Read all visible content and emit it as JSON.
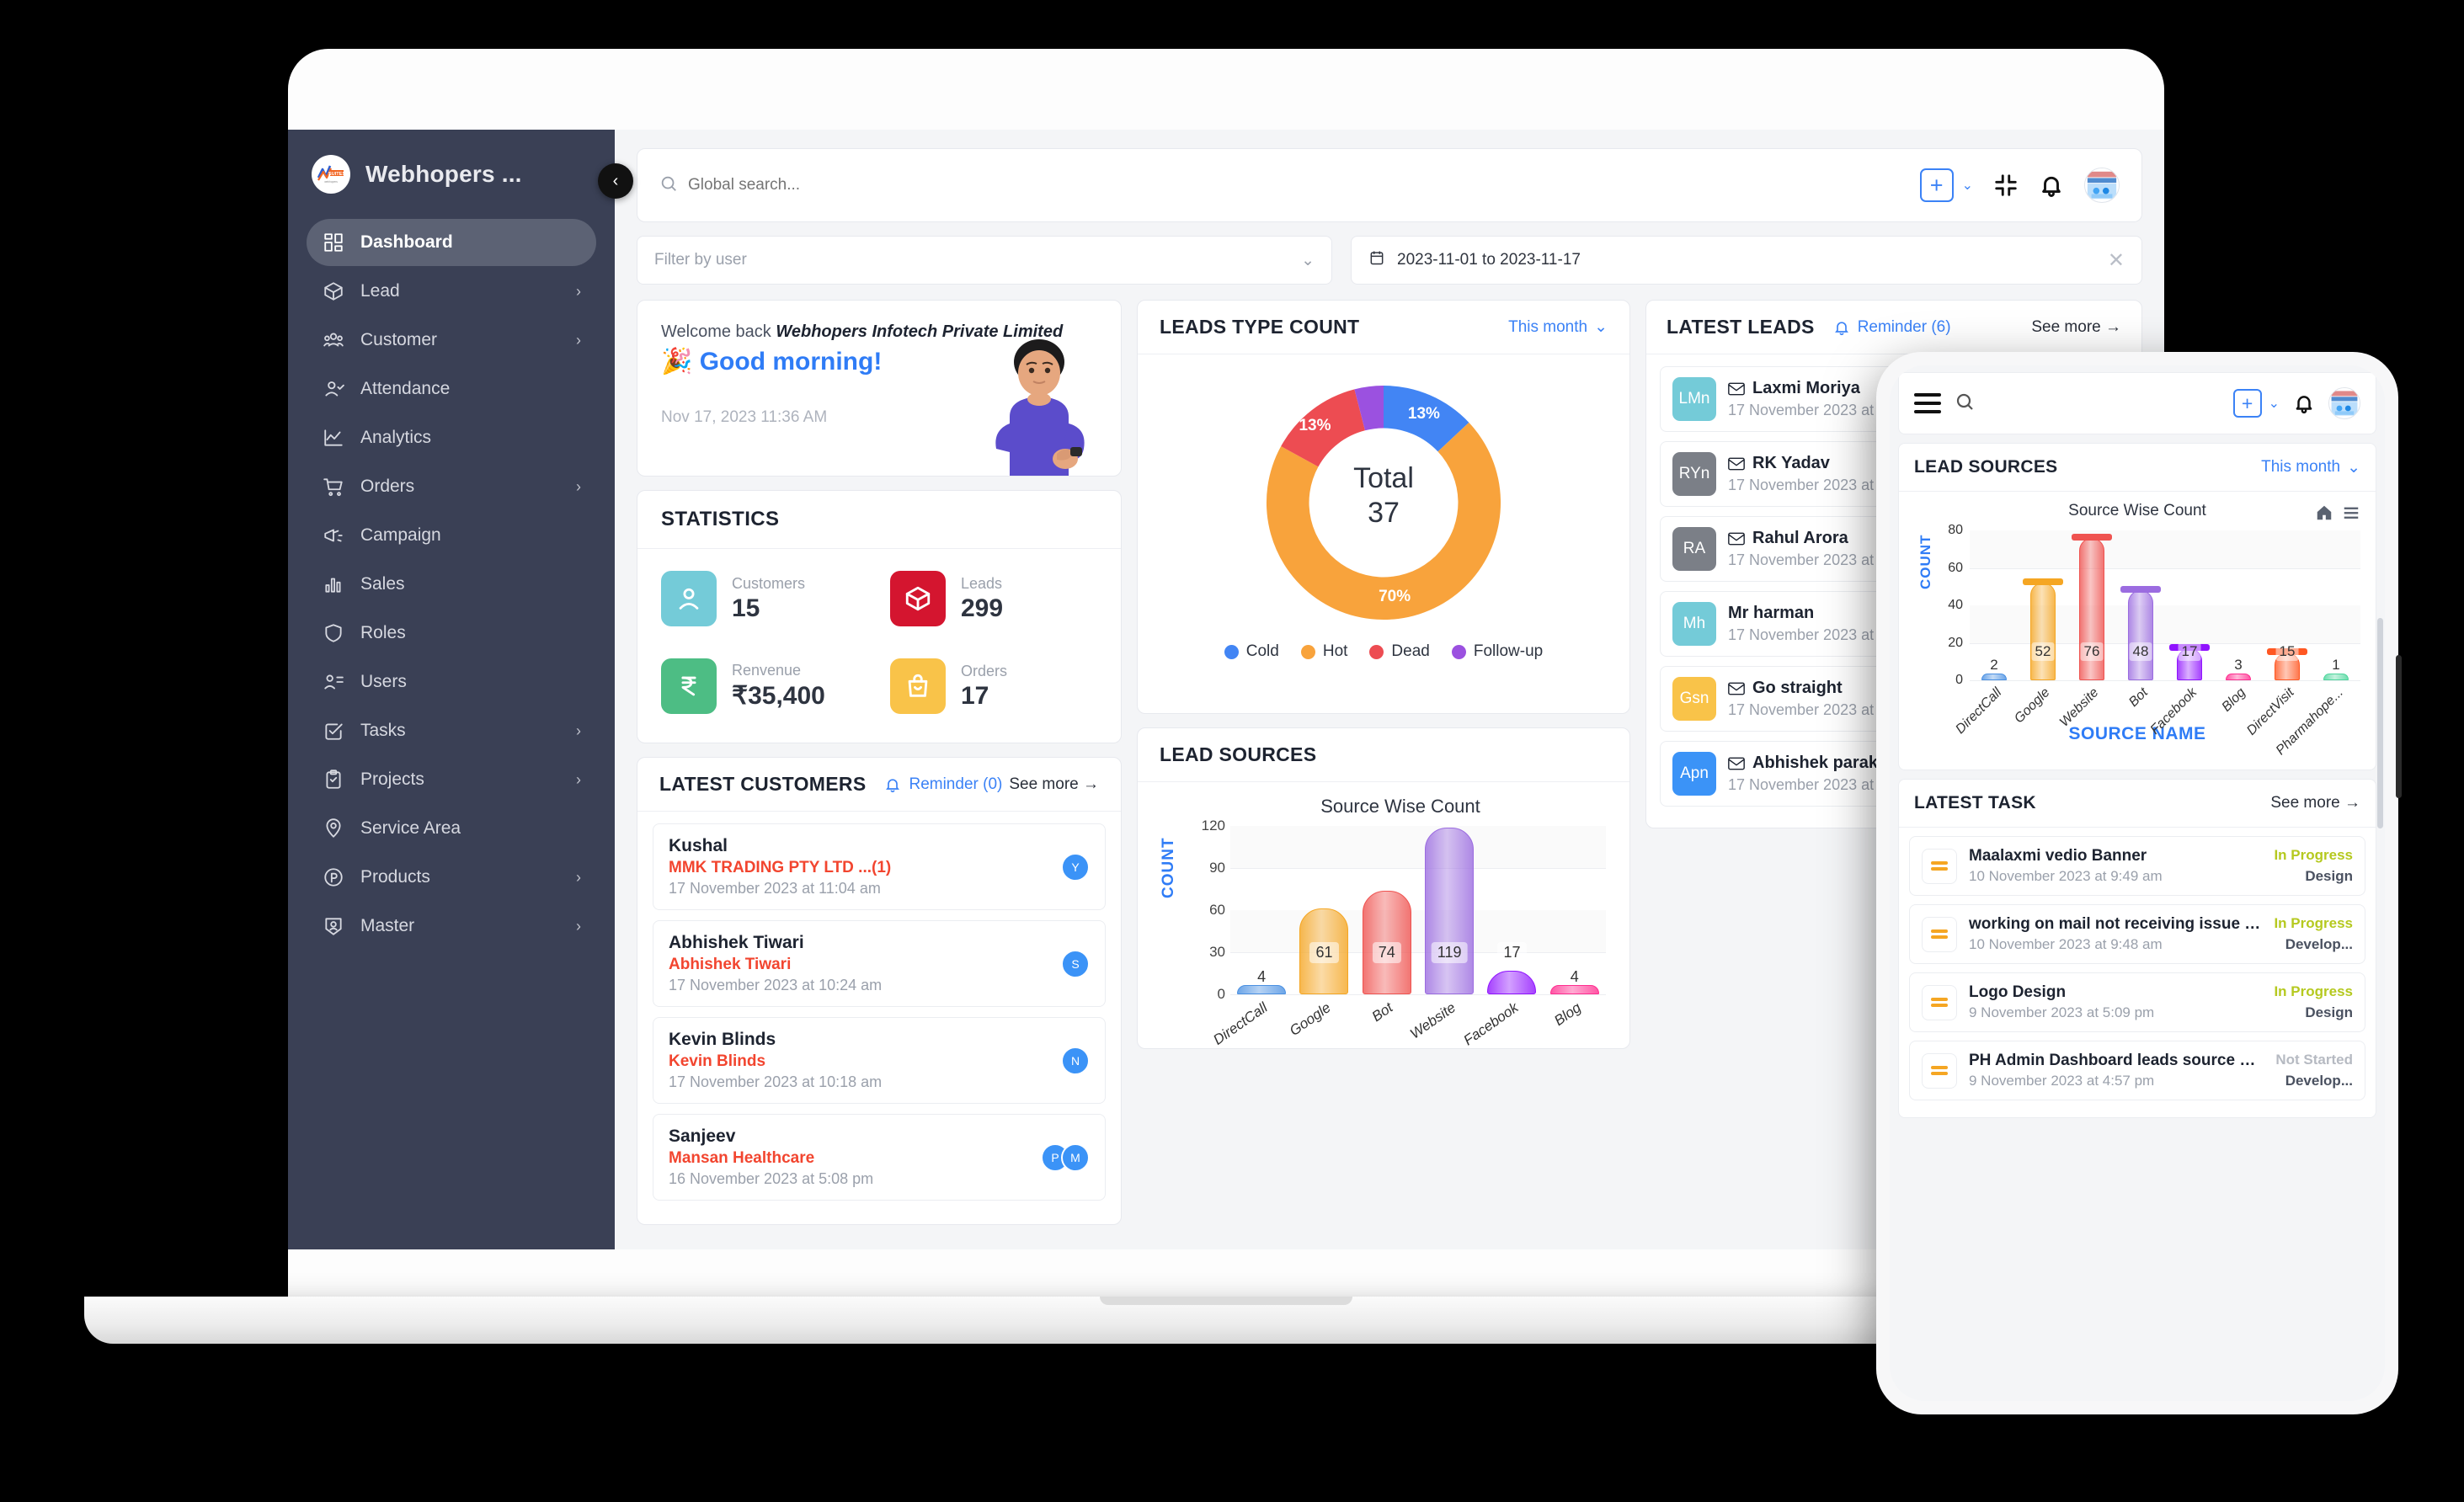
{
  "sidebar": {
    "brand": "Webhopers ...",
    "logo_text": "WHSUITES",
    "collapse": "‹",
    "items": [
      {
        "label": "Dashboard",
        "icon": "grid-icon",
        "arrow": "",
        "active": true
      },
      {
        "label": "Lead",
        "icon": "box-icon",
        "arrow": "›",
        "active": false
      },
      {
        "label": "Customer",
        "icon": "people-icon",
        "arrow": "›",
        "active": false
      },
      {
        "label": "Attendance",
        "icon": "user-check-icon",
        "arrow": "",
        "active": false
      },
      {
        "label": "Analytics",
        "icon": "line-chart-icon",
        "arrow": "",
        "active": false
      },
      {
        "label": "Orders",
        "icon": "cart-icon",
        "arrow": "›",
        "active": false
      },
      {
        "label": "Campaign",
        "icon": "megaphone-icon",
        "arrow": "",
        "active": false
      },
      {
        "label": "Sales",
        "icon": "bar-chart-icon",
        "arrow": "",
        "active": false
      },
      {
        "label": "Roles",
        "icon": "shield-icon",
        "arrow": "",
        "active": false
      },
      {
        "label": "Users",
        "icon": "users-list-icon",
        "arrow": "",
        "active": false
      },
      {
        "label": "Tasks",
        "icon": "check-square-icon",
        "arrow": "›",
        "active": false
      },
      {
        "label": "Projects",
        "icon": "clipboard-icon",
        "arrow": "›",
        "active": false
      },
      {
        "label": "Service Area",
        "icon": "map-pin-icon",
        "arrow": "",
        "active": false
      },
      {
        "label": "Products",
        "icon": "p-circle-icon",
        "arrow": "›",
        "active": false
      },
      {
        "label": "Master",
        "icon": "badge-user-icon",
        "arrow": "›",
        "active": false
      }
    ]
  },
  "topbar": {
    "search_placeholder": "Global search...",
    "search_value": "",
    "plus_label": "+",
    "chevron": "⌄"
  },
  "filters": {
    "user_placeholder": "Filter by user",
    "user_chevron": "⌄",
    "date_value": "2023-11-01 to 2023-11-17",
    "clear": "✕"
  },
  "welcome": {
    "greeting_prefix": "Welcome back ",
    "company": "Webhopers Infotech Private Limited",
    "emoji": "🎉",
    "greeting": "Good morning!",
    "timestamp": "Nov 17, 2023 11:36 AM"
  },
  "statistics": {
    "title": "STATISTICS",
    "items": [
      {
        "label": "Customers",
        "value": "15",
        "color": "#74cbd8",
        "icon": "user-icon"
      },
      {
        "label": "Leads",
        "value": "299",
        "color": "#d4152f",
        "icon": "box-icon"
      },
      {
        "label": "Renvenue",
        "value": "₹35,400",
        "color": "#4dbd84",
        "icon": "rupee-icon"
      },
      {
        "label": "Orders",
        "value": "17",
        "color": "#f9c349",
        "icon": "bag-icon"
      }
    ]
  },
  "latest_customers": {
    "title": "LATEST CUSTOMERS",
    "reminder": "Reminder (0)",
    "see_more": "See more →",
    "rows": [
      {
        "name": "Kushal",
        "org": "MMK TRADING PTY LTD  ...(1)",
        "date": "17 November 2023 at 11:04 am",
        "avatars": [
          "Y"
        ]
      },
      {
        "name": "Abhishek Tiwari",
        "org": "Abhishek Tiwari",
        "date": "17 November 2023 at 10:24 am",
        "avatars": [
          "S"
        ]
      },
      {
        "name": "Kevin Blinds",
        "org": "Kevin Blinds",
        "date": "17 November 2023 at 10:18 am",
        "avatars": [
          "N"
        ]
      },
      {
        "name": "Sanjeev",
        "org": "Mansan Healthcare",
        "date": "16 November 2023 at 5:08 pm",
        "avatars": [
          "P",
          "M"
        ]
      }
    ]
  },
  "leads_type_count": {
    "title": "LEADS TYPE COUNT",
    "period": "This month",
    "chevron": "⌄",
    "center_label": "Total",
    "center_value": "37"
  },
  "lead_sources_desktop": {
    "title": "LEAD SOURCES"
  },
  "latest_leads": {
    "title": "LATEST LEADS",
    "reminder": "Reminder (6)",
    "see_more": "See more →",
    "rows": [
      {
        "initials": "LMn",
        "color": "#74cbd8",
        "name": "Laxmi Moriya",
        "date": "17 November 2023 at 11:",
        "mail": true
      },
      {
        "initials": "RYn",
        "color": "#7b7f87",
        "name": "RK Yadav",
        "date": "17 November 2023 at 10:",
        "mail": true
      },
      {
        "initials": "RA",
        "color": "#7b7f87",
        "name": "Rahul Arora",
        "date": "17 November 2023 at 9:3",
        "mail": true
      },
      {
        "initials": "Mh",
        "color": "#74cbd8",
        "name": "Mr harman",
        "date": "17 November 2023 at 9:0",
        "mail": false
      },
      {
        "initials": "Gsn",
        "color": "#f9c349",
        "name": "Go straight",
        "date": "17 November 2023 at 5:3",
        "mail": true
      },
      {
        "initials": "Apn",
        "color": "#3b93f7",
        "name": "Abhishek parakkat",
        "date": "17 November 2023 at 1:4",
        "mail": true
      }
    ]
  },
  "phone": {
    "lead_sources": {
      "title": "LEAD SOURCES",
      "period": "This month",
      "chevron": "⌄",
      "source_name": "SOURCE NAME"
    },
    "latest_task": {
      "title": "LATEST TASK",
      "see_more": "See more →",
      "rows": [
        {
          "name": "Maalaxmi vedio Banner",
          "date": "10 November 2023 at 9:49 am",
          "status": "In Progress",
          "status_color": "#b5c91f",
          "category": "Design"
        },
        {
          "name": "working on mail not receiving issue in ...",
          "date": "10 November 2023 at 9:48 am",
          "status": "In Progress",
          "status_color": "#b5c91f",
          "category": "Develop..."
        },
        {
          "name": "Logo Design",
          "date": "9 November 2023 at 5:09 pm",
          "status": "In Progress",
          "status_color": "#b5c91f",
          "category": "Design"
        },
        {
          "name": "PH Admin Dashboard leads source wi...",
          "date": "9 November 2023 at 4:57 pm",
          "status": "Not Started",
          "status_color": "#b6bac2",
          "category": "Develop..."
        }
      ]
    }
  },
  "chart_data": [
    {
      "type": "pie",
      "title": "LEADS TYPE COUNT",
      "subtitle": "Total 37",
      "legend_position": "bottom",
      "labels": [
        "Cold",
        "Hot",
        "Dead",
        "Follow-up"
      ],
      "values": [
        13,
        70,
        13,
        4
      ],
      "value_unit": "%",
      "data_labels": [
        "13%",
        "70%",
        "13%",
        ""
      ],
      "colors": [
        "#4285f4",
        "#f8a33c",
        "#ed4c52",
        "#9b51e0"
      ],
      "total": 37
    },
    {
      "type": "bar",
      "title": "Source Wise Count",
      "panel": "LEAD SOURCES (desktop)",
      "xlabel": "",
      "ylabel": "COUNT",
      "ylim": [
        0,
        120
      ],
      "yticks": [
        0,
        30,
        60,
        90,
        120
      ],
      "grid": true,
      "categories": [
        "DirectCall",
        "Google",
        "Bot",
        "Website",
        "Facebook",
        "Blog"
      ],
      "values": [
        4,
        61,
        74,
        119,
        17,
        4
      ],
      "colors": [
        "#4a90e2",
        "#f5a623",
        "#ef5350",
        "#9b6ce0",
        "#9013fe",
        "#ff2d8f"
      ]
    },
    {
      "type": "bar",
      "title": "Source Wise Count",
      "panel": "LEAD SOURCES (mobile)",
      "xlabel": "SOURCE NAME",
      "ylabel": "COUNT",
      "ylim": [
        0,
        80
      ],
      "yticks": [
        0,
        20,
        40,
        60,
        80
      ],
      "grid": true,
      "categories": [
        "DirectCall",
        "Google",
        "Website",
        "Bot",
        "Facebook",
        "Blog",
        "DirectVisit",
        "Pharmahope..."
      ],
      "values": [
        2,
        52,
        76,
        48,
        17,
        3,
        15,
        1
      ],
      "colors": [
        "#4a90e2",
        "#f5a623",
        "#ef5350",
        "#9b6ce0",
        "#9013fe",
        "#ff2d8f",
        "#ff5722",
        "#4dd69c"
      ]
    }
  ]
}
